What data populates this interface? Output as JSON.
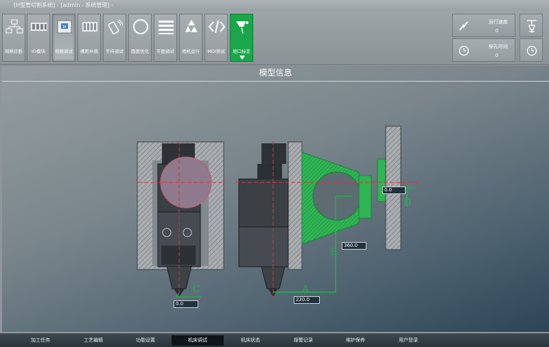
{
  "window": {
    "title": "[H型管切割系统] - [admin - 系统管理] -"
  },
  "toolbar": {
    "items": [
      {
        "label": "网络诊断",
        "icon": "network-icon"
      },
      {
        "label": "IO模块",
        "icon": "io-module-icon"
      },
      {
        "label": "伺服调试",
        "icon": "servo-icon"
      },
      {
        "label": "螺距补偿",
        "icon": "pitch-compensation-icon"
      },
      {
        "label": "手持调试",
        "icon": "handheld-icon"
      },
      {
        "label": "圆度优化",
        "icon": "roundness-icon"
      },
      {
        "label": "平面调试",
        "icon": "plane-icon"
      },
      {
        "label": "烤机运行",
        "icon": "recycle-icon"
      },
      {
        "label": "MDI测试",
        "icon": "code-icon"
      },
      {
        "label": "坡口标定",
        "icon": "bevel-calibration-icon"
      }
    ]
  },
  "status": {
    "speed_label": "运行速度",
    "speed_value": "0",
    "pierce_label": "穿孔时间",
    "pierce_value": "0"
  },
  "main": {
    "title": "模型信息",
    "values": {
      "c_val": "0.0",
      "a_val": "220.0",
      "b_val": "360.0",
      "d_val": "0.0"
    },
    "letters": {
      "c": "C",
      "a": "A",
      "b": "B",
      "d": "D"
    }
  },
  "colors": {
    "accent": "#1aa64a",
    "guide": "#22b24c",
    "axis": "#e0303a"
  },
  "bottom_tabs": [
    "加工任务",
    "工艺编辑",
    "功能设置",
    "机床调试",
    "机床状态",
    "报警记录",
    "维护保养",
    "用户登录"
  ],
  "active_tab": "机床调试"
}
